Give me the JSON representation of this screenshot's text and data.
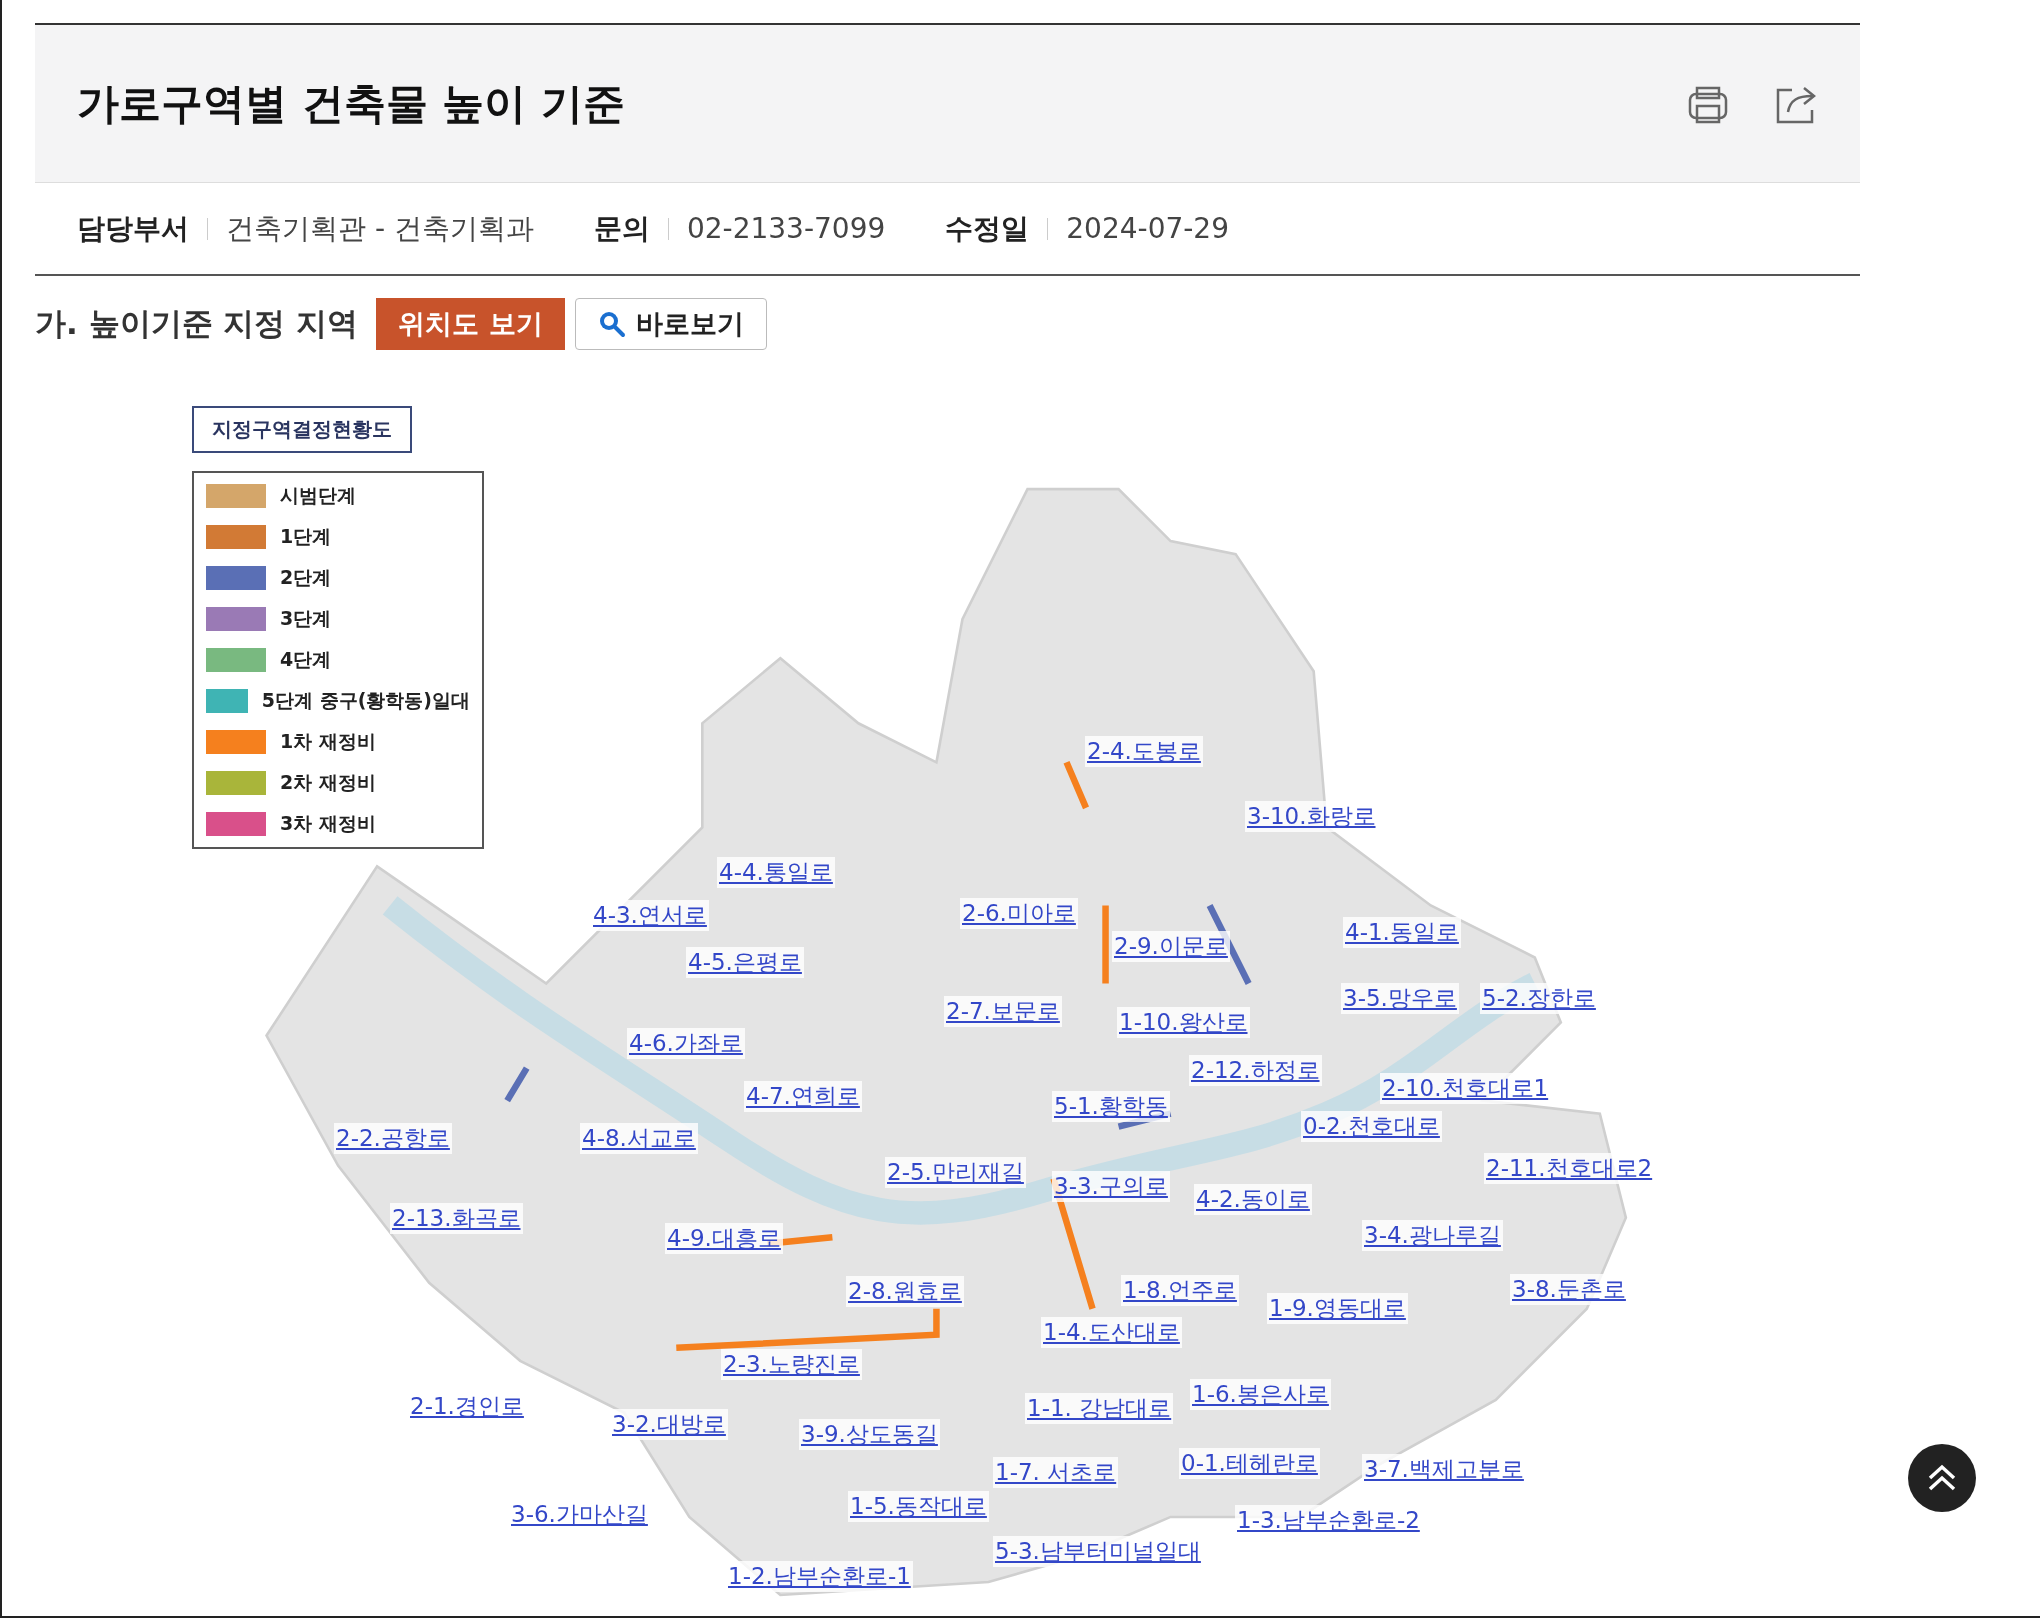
{
  "header": {
    "title": "가로구역별 건축물 높이 기준"
  },
  "info": [
    {
      "label": "담당부서",
      "value": "건축기획관 - 건축기획과"
    },
    {
      "label": "문의",
      "value": "02-2133-7099"
    },
    {
      "label": "수정일",
      "value": "2024-07-29"
    }
  ],
  "section": {
    "heading": "가. 높이기준 지정 지역",
    "buttons": [
      {
        "kind": "primary",
        "label": "위치도 보기"
      },
      {
        "kind": "search",
        "label": "바로보기"
      }
    ]
  },
  "map": {
    "legend": {
      "title": "지정구역결정현황도",
      "items": [
        {
          "label": "시범단계",
          "color": "#d4a66a"
        },
        {
          "label": "1단계",
          "color": "#d27a35"
        },
        {
          "label": "2단계",
          "color": "#5a6fb5"
        },
        {
          "label": "3단계",
          "color": "#9a7ab5"
        },
        {
          "label": "4단계",
          "color": "#79b980"
        },
        {
          "label": "5단계 중구(황학동)일대",
          "color": "#3fb4b4"
        },
        {
          "label": "1차 재정비",
          "color": "#f5801e"
        },
        {
          "label": "2차 재정비",
          "color": "#a9b53a"
        },
        {
          "label": "3차 재정비",
          "color": "#d9508a"
        }
      ]
    },
    "links": [
      "2-4.도봉로",
      "3-10.화랑로",
      "4-4.통일로",
      "4-3.연서로",
      "2-6.미아로",
      "2-9.이문로",
      "4-1.동일로",
      "4-5.은평로",
      "2-7.보문로",
      "1-10.왕산로",
      "3-5.망우로",
      "5-2.장한로",
      "4-6.가좌로",
      "2-12.하정로",
      "4-7.연희로",
      "5-1.황학동",
      "2-10.천호대로1",
      "2-2.공항로",
      "4-8.서교로",
      "0-2.천호대로",
      "2-5.만리재길",
      "2-11.천호대로2",
      "3-3.구의로",
      "4-2.동이로",
      "2-13.화곡로",
      "4-9.대흥로",
      "3-4.광나루길",
      "2-8.원효로",
      "1-8.언주로",
      "3-8.둔촌로",
      "1-9.영동대로",
      "1-4.도산대로",
      "2-3.노량진로",
      "1-6.봉은사로",
      "2-1.경인로",
      "1-1. 강남대로",
      "3-2.대방로",
      "3-9.상도동길",
      "1-7. 서초로",
      "0-1.테헤란로",
      "3-7.백제고분로",
      "3-6.가마산길",
      "1-5.동작대로",
      "1-3.남부순환로-2",
      "5-3.남부터미널일대",
      "1-2.남부순환로-1"
    ]
  }
}
